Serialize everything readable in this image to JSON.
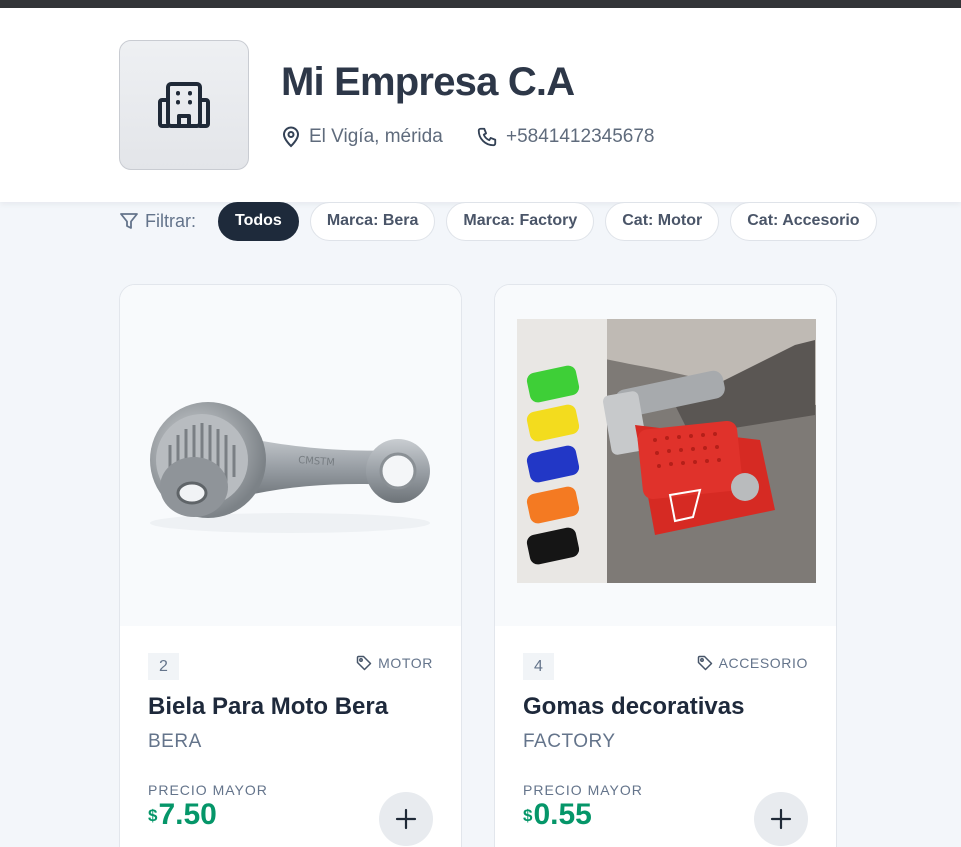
{
  "company": {
    "name": "Mi Empresa C.A",
    "location": "El Vigía, mérida",
    "phone": "+5841412345678",
    "logo_icon": "building-icon"
  },
  "filters": {
    "label": "Filtrar:",
    "chips": [
      "Todos",
      "Marca: Bera",
      "Marca: Factory",
      "Cat: Motor",
      "Cat: Accesorio"
    ],
    "active": "Todos"
  },
  "products": [
    {
      "qty": "2",
      "category": "MOTOR",
      "name": "Biela Para Moto Bera",
      "brand": "BERA",
      "price_label": "PRECIO MAYOR",
      "currency": "$",
      "price": "7.50",
      "image": "connecting-rod-photo"
    },
    {
      "qty": "4",
      "category": "ACCESORIO",
      "name": "Gomas decorativas",
      "brand": "FACTORY",
      "price_label": "PRECIO MAYOR",
      "currency": "$",
      "price": "0.55",
      "image": "gear-shift-pad-photo"
    }
  ],
  "colors": {
    "accent": "#1e2a3b",
    "price": "#059669",
    "topbar": "#333538"
  }
}
